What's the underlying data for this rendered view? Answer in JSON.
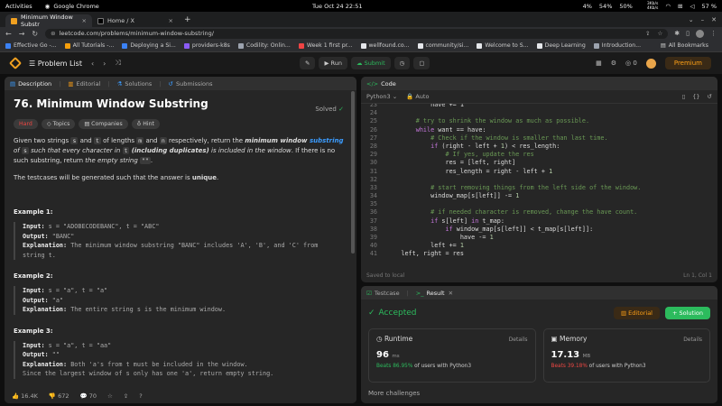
{
  "gnome": {
    "activities": "Activities",
    "app": "Google Chrome",
    "clock": "Tue Oct 24  22:51",
    "brightness": "4%",
    "volume": "54%",
    "mic": "50%",
    "net_up": "3Kb/s",
    "net_down": "4Kb/s",
    "battery": "57 %"
  },
  "tabs": [
    {
      "title": "Minimum Window Substr",
      "close": "×"
    },
    {
      "title": "Home / X",
      "close": "×"
    }
  ],
  "new_tab": "+",
  "address": {
    "url": "leetcode.com/problems/minimum-window-substring/"
  },
  "bookmarks": [
    {
      "label": "Effective Go -...",
      "color": "#3b82f6"
    },
    {
      "label": "All Tutorials -...",
      "color": "#f59e0b"
    },
    {
      "label": "Deploying a Si...",
      "color": "#3b82f6"
    },
    {
      "label": "providers-k8s",
      "color": "#8b5cf6"
    },
    {
      "label": "Codility: Onlin...",
      "color": "#9ca3af"
    },
    {
      "label": "Week 1 first pr...",
      "color": "#ef4444"
    },
    {
      "label": "wellfound.co...",
      "color": "#e5e7eb"
    },
    {
      "label": "community/si...",
      "color": "#e5e7eb"
    },
    {
      "label": "Welcome to S...",
      "color": "#e5e7eb"
    },
    {
      "label": "Deep Learning",
      "color": "#e5e7eb"
    },
    {
      "label": "Introduction...",
      "color": "#9ca3af"
    }
  ],
  "all_bookmarks": "All Bookmarks",
  "lc": {
    "problem_list": "Problem List",
    "run": "Run",
    "submit": "Submit",
    "coins": "0",
    "premium": "Premium"
  },
  "left_tabs": {
    "description": "Description",
    "editorial": "Editorial",
    "solutions": "Solutions",
    "submissions": "Submissions"
  },
  "problem": {
    "title": "76. Minimum Window Substring",
    "solved": "Solved",
    "difficulty": "Hard",
    "topics": "Topics",
    "companies": "Companies",
    "hint": "Hint",
    "p1a": "Given two strings ",
    "s": "s",
    "p1b": " and ",
    "t": "t",
    "p1c": " of lengths ",
    "m": "m",
    "p1d": " and ",
    "n": "n",
    "p1e": " respectively, return the ",
    "p1f": "minimum window ",
    "p1g": "substring",
    "p1h": " of ",
    "p1i": " such that every character in ",
    "p1j": "(including duplicates)",
    "p1k": " is included in the window",
    "p1l": ". If there is no such substring, return ",
    "p1m": "the empty string ",
    "empty": "\"\"",
    "p1n": ".",
    "p2a": "The testcases will be generated such that the answer is ",
    "p2b": "unique",
    "p2c": ".",
    "examples": [
      {
        "title": "Example 1:",
        "input": "s = \"ADOBECODEBANC\", t = \"ABC\"",
        "output": "\"BANC\"",
        "explanation": "The minimum window substring \"BANC\" includes 'A', 'B', and 'C' from",
        "explanation2": "string t."
      },
      {
        "title": "Example 2:",
        "input": "s = \"a\", t = \"a\"",
        "output": "\"a\"",
        "explanation": "The entire string s is the minimum window."
      },
      {
        "title": "Example 3:",
        "input": "s = \"a\", t = \"aa\"",
        "output": "\"\"",
        "explanation": "Both 'a's from t must be included in the window.",
        "explanation2": "Since the largest window of s only has one 'a', return empty string."
      }
    ],
    "labels": {
      "input": "Input:",
      "output": "Output:",
      "explanation": "Explanation:"
    }
  },
  "footer": {
    "likes": "16.4K",
    "dislikes": "672",
    "comments": "70"
  },
  "code": {
    "header": "Code",
    "lang": "Python3",
    "auto": "Auto",
    "saved": "Saved to local",
    "cursor": "Ln 1, Col 1"
  },
  "result": {
    "testcase": "Testcase",
    "result": "Result",
    "status": "Accepted",
    "editorial": "Editorial",
    "solution": "+ Solution",
    "runtime": {
      "label": "Runtime",
      "details": "Details",
      "value": "96",
      "unit": "ms",
      "beats": "Beats 86.95%",
      "rest": " of users with Python3"
    },
    "memory": {
      "label": "Memory",
      "details": "Details",
      "value": "17.13",
      "unit": "MB",
      "beats": "Beats 39.18%",
      "rest": " of users with Python3"
    },
    "more": "More challenges"
  }
}
